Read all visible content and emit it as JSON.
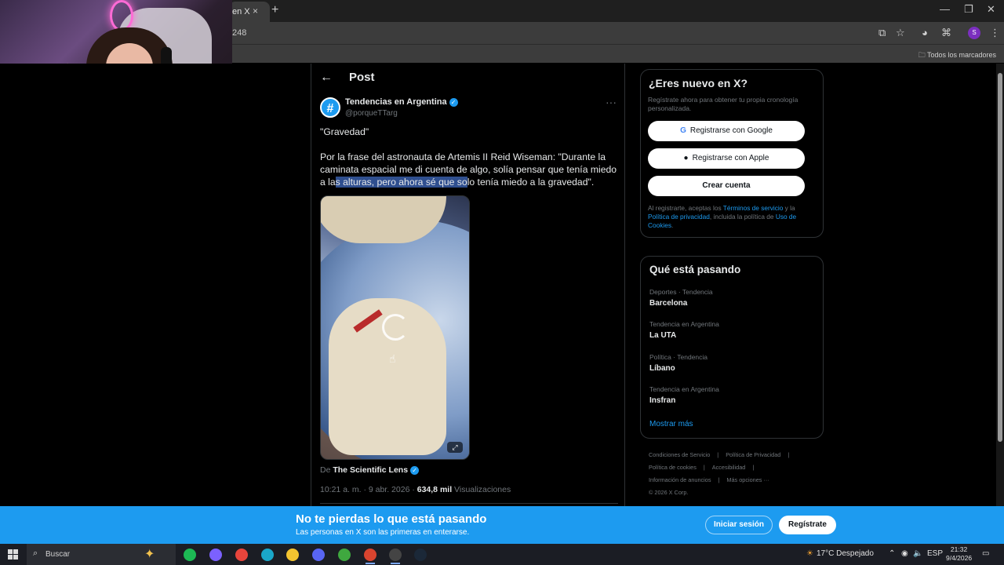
{
  "browser": {
    "tab_title": "en X",
    "tab_close": "×",
    "new_tab": "+",
    "url_fragment": "248",
    "bookmarks_all": "Todos los marcadores",
    "profile_initial": "S",
    "window_controls": [
      "—",
      "❐",
      "✕"
    ]
  },
  "post": {
    "header_title": "Post",
    "author_name": "Tendencias en Argentina",
    "author_handle": "@porqueTTarg",
    "more": "···",
    "text_p1": "\"Gravedad\"",
    "text_p2_before": "Por la frase del astronauta de Artemis II Reid Wiseman: \"Durante la caminata espacial me di cuenta de algo, solía pensar que tenía miedo a la",
    "text_p2_highlight": "s alturas, pero ahora sé que so",
    "text_p2_after": "lo tenía miedo a la gravedad\".",
    "credit_prefix": "De",
    "credit_name": "The Scientific Lens",
    "timestamp": "10:21 a. m. · 9 abr. 2026 ·",
    "views_count": "634,8 mil",
    "views_label": "Visualizaciones"
  },
  "signup_card": {
    "title": "¿Eres nuevo en X?",
    "subtitle": "Regístrate ahora para obtener tu propia cronología personalizada.",
    "google_label": "Registrarse con Google",
    "apple_label": "Registrarse con Apple",
    "create_label": "Crear cuenta",
    "legal_1": "Al registrarte, aceptas los",
    "legal_terms": "Términos de servicio",
    "legal_2": "y la",
    "legal_privacy": "Política de privacidad",
    "legal_3": ", incluida la política de",
    "legal_cookies": "Uso de Cookies",
    "legal_4": "."
  },
  "trends": {
    "title": "Qué está pasando",
    "items": [
      {
        "context": "Deportes · Tendencia",
        "name": "Barcelona"
      },
      {
        "context": "Tendencia en Argentina",
        "name": "La UTA"
      },
      {
        "context": "Política · Tendencia",
        "name": "Líbano"
      },
      {
        "context": "Tendencia en Argentina",
        "name": "Insfran"
      }
    ],
    "show_more": "Mostrar más"
  },
  "footer": {
    "links": [
      "Condiciones de Servicio",
      "|",
      "Política de Privacidad",
      "|",
      "Política de cookies",
      "|",
      "Accesibilidad",
      "|",
      "Información de anuncios",
      "|",
      "Más opciones ···"
    ],
    "copyright": "© 2026 X Corp."
  },
  "banner": {
    "title": "No te pierdas lo que está pasando",
    "subtitle": "Las personas en X son las primeras en enterarse.",
    "login_label": "Iniciar sesión",
    "signup_label": "Regístrate"
  },
  "taskbar": {
    "search_placeholder": "Buscar",
    "weather_temp": "17°C",
    "weather_desc": "Despejado",
    "language": "ESP",
    "time": "21:32",
    "date": "9/4/2026",
    "apps": [
      {
        "name": "spotify",
        "color": "#1db954"
      },
      {
        "name": "copilot",
        "color": "#7b61ff"
      },
      {
        "name": "chrome",
        "color": "#e8453c"
      },
      {
        "name": "app-cyan",
        "color": "#1aa7c9"
      },
      {
        "name": "file-explorer",
        "color": "#f4c430"
      },
      {
        "name": "discord",
        "color": "#5865f2"
      },
      {
        "name": "xbox",
        "color": "#3fa83f"
      },
      {
        "name": "chrome-2",
        "color": "#d9442f"
      },
      {
        "name": "obs",
        "color": "#444"
      },
      {
        "name": "steam",
        "color": "#1b2838"
      }
    ]
  },
  "colors": {
    "accent": "#1d9bf0",
    "background": "#000000",
    "text": "#e7e9ea",
    "muted": "#71767b"
  }
}
